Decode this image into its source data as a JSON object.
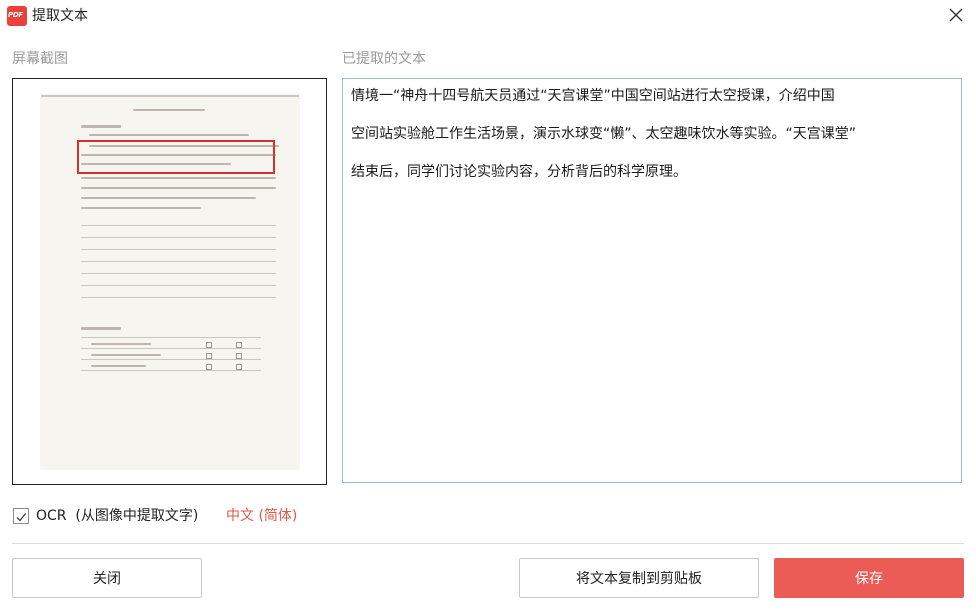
{
  "window": {
    "title": "提取文本",
    "icon": "pdf-app-icon",
    "icon_text": "PDF"
  },
  "left_panel": {
    "label": "屏幕截图"
  },
  "right_panel": {
    "label": "已提取的文本",
    "paragraphs": [
      "情境一“神舟十四号航天员通过“天宫课堂”中国空间站进行太空授课，介绍中国",
      "空间站实验舱工作生活场景，演示水球变“懒”、太空趣味饮水等实验。“天宫课堂”",
      "结束后，同学们讨论实验内容，分析背后的科学原理。"
    ]
  },
  "ocr": {
    "checked": true,
    "label": "OCR  (从图像中提取文字)",
    "language": "中文 (简体)"
  },
  "buttons": {
    "close": "关闭",
    "copy": "将文本复制到剪贴板",
    "save": "保存"
  },
  "colors": {
    "accent": "#ec5c57",
    "language_link": "#e2574c",
    "text_area_border": "#9bbbd8",
    "highlight_box": "#d8302c"
  }
}
